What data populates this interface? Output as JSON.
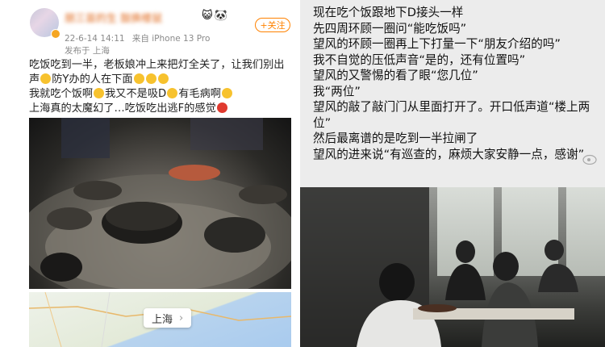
{
  "post": {
    "user": {
      "name": "朋三苗的生 鼓换楼鼠",
      "badges": "😺🐼"
    },
    "meta": {
      "date": "22-6-14 14:11",
      "device": "来自 iPhone 13 Pro",
      "location": "发布于 上海"
    },
    "follow_label": "+关注",
    "text": {
      "line1": "吃饭吃到一半，老板娘冲上来把灯全关了，让我们别出声",
      "line1b": "防Y办的人在下面",
      "line2": "我就吃个饭啊",
      "line2b": "我又不是吸D",
      "line2c": "有毛病啊",
      "line3": "上海真的太魔幻了…吃饭吃出逃F的感觉"
    },
    "map_label": "上海",
    "map_chevron": "›"
  },
  "chat_screenshot": {
    "lines": [
      "现在吃个饭跟地下D接头一样",
      "先四周环顾一圈问“能吃饭吗”",
      "望风的环顾一圈再上下打量一下“朋友介绍的吗”",
      "我不自觉的压低声音“是的，还有位置吗”",
      "望风的又警惕的看了眼“您几位”",
      "我“两位”",
      "望风的敲了敲门门从里面打开了。开口低声道“楼上两位”",
      "然后最离谱的是吃到一半拉闸了",
      "望风的进来说“有巡查的，麻烦大家安静一点，感谢”"
    ]
  },
  "colors": {
    "accent": "#ff8200",
    "username": "#e06a1e"
  }
}
